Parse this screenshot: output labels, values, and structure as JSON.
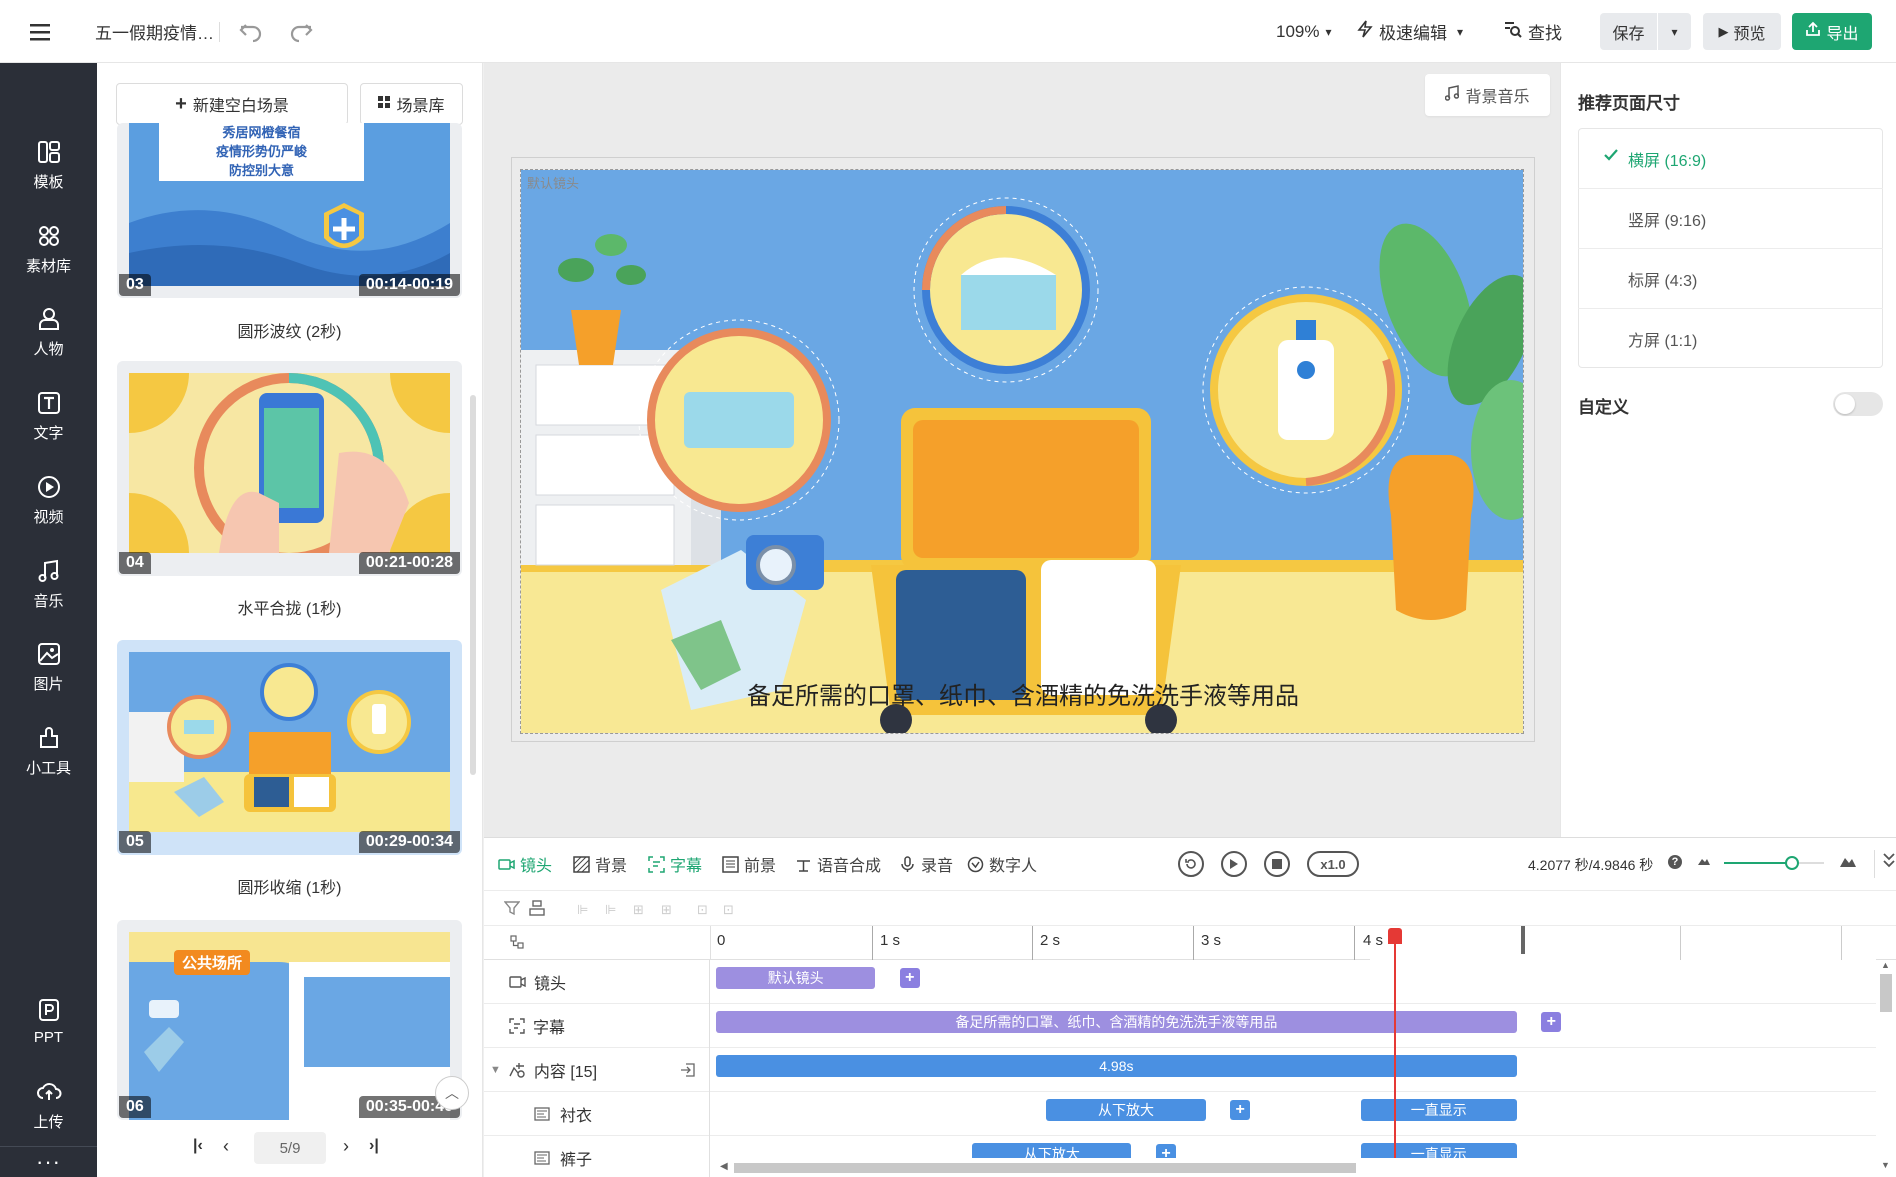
{
  "topbar": {
    "doc_title": "五一假期疫情…",
    "zoom": "109%",
    "edit_mode": "极速编辑",
    "find_label": "查找",
    "save_label": "保存",
    "preview_label": "预览",
    "export_label": "导出"
  },
  "sidebar": {
    "items": [
      {
        "label": "模板",
        "icon": "template-icon"
      },
      {
        "label": "素材库",
        "icon": "assets-icon"
      },
      {
        "label": "人物",
        "icon": "person-icon"
      },
      {
        "label": "文字",
        "icon": "text-icon"
      },
      {
        "label": "视频",
        "icon": "video-icon"
      },
      {
        "label": "音乐",
        "icon": "music-icon"
      },
      {
        "label": "图片",
        "icon": "image-icon"
      },
      {
        "label": "小工具",
        "icon": "tools-icon"
      }
    ],
    "bottom": [
      {
        "label": "PPT",
        "icon": "ppt-icon"
      },
      {
        "label": "上传",
        "icon": "upload-icon"
      }
    ]
  },
  "scene_panel": {
    "new_scene_label": "新建空白场景",
    "library_label": "场景库",
    "scenes": [
      {
        "num": "03",
        "time": "00:14-00:19",
        "transition": "圆形波纹 (2秒)",
        "thumb_text": [
          "秀居网橙餐宿",
          "疫情形势仍严峻",
          "防控别大意"
        ]
      },
      {
        "num": "04",
        "time": "00:21-00:28",
        "transition": "水平合拢 (1秒)"
      },
      {
        "num": "05",
        "time": "00:29-00:34",
        "transition": "圆形收缩 (1秒)"
      },
      {
        "num": "06",
        "time": "00:35-00:40",
        "transition": "",
        "thumb_text": [
          "公共场所"
        ]
      }
    ],
    "pager": {
      "current": "5/9"
    }
  },
  "canvas": {
    "bg_music_label": "背景音乐",
    "camera_tag": "默认镜头",
    "subtitle": "备足所需的口罩、纸巾、含酒精的免洗洗手液等用品"
  },
  "right_panel": {
    "title": "推荐页面尺寸",
    "sizes": [
      {
        "label": "横屏 (16:9)",
        "selected": true
      },
      {
        "label": "竖屏 (9:16)",
        "selected": false
      },
      {
        "label": "标屏 (4:3)",
        "selected": false
      },
      {
        "label": "方屏 (1:1)",
        "selected": false
      }
    ],
    "custom_label": "自定义",
    "custom_enabled": false
  },
  "timeline": {
    "tabs": [
      {
        "label": "镜头",
        "active": true
      },
      {
        "label": "背景",
        "active": false
      },
      {
        "label": "字幕",
        "active": true
      },
      {
        "label": "前景",
        "active": false
      },
      {
        "label": "语音合成",
        "active": false
      },
      {
        "label": "录音",
        "active": false
      },
      {
        "label": "数字人",
        "active": false
      }
    ],
    "speed": "x1.0",
    "time_readout": "4.2077 秒/4.9846 秒",
    "ruler": [
      "0",
      "1 s",
      "2 s",
      "3 s",
      "4 s"
    ],
    "playhead_seconds": 4.2077,
    "duration_seconds": 4.9846,
    "zoom_level": 0.68,
    "rows": [
      {
        "label": "镜头",
        "clips": [
          {
            "text": "默认镜头",
            "start": 0,
            "end": 1.0,
            "color": "purple"
          }
        ],
        "plus_at": 1.14
      },
      {
        "label": "字幕",
        "clips": [
          {
            "text": "备足所需的口罩、纸巾、含酒精的免洗洗手液等用品",
            "start": 0,
            "end": 4.98,
            "color": "purple"
          }
        ],
        "plus_at": 5.12
      },
      {
        "label": "内容 [15]",
        "clips": [
          {
            "text": "4.98s",
            "start": 0,
            "end": 4.98,
            "color": "blue"
          }
        ]
      },
      {
        "label": "衬衣",
        "clips": [
          {
            "text": "从下放大",
            "start": 2.05,
            "end": 3.05,
            "color": "blue"
          },
          {
            "text": "一直显示",
            "start": 4.0,
            "end": 4.98,
            "color": "blue"
          }
        ],
        "plus_at": 3.19
      },
      {
        "label": "裤子",
        "clips": [
          {
            "text": "从下放大",
            "start": 1.59,
            "end": 2.59,
            "color": "blue"
          },
          {
            "text": "一直显示",
            "start": 4.0,
            "end": 4.98,
            "color": "blue"
          }
        ],
        "plus_at": 2.73
      }
    ]
  }
}
